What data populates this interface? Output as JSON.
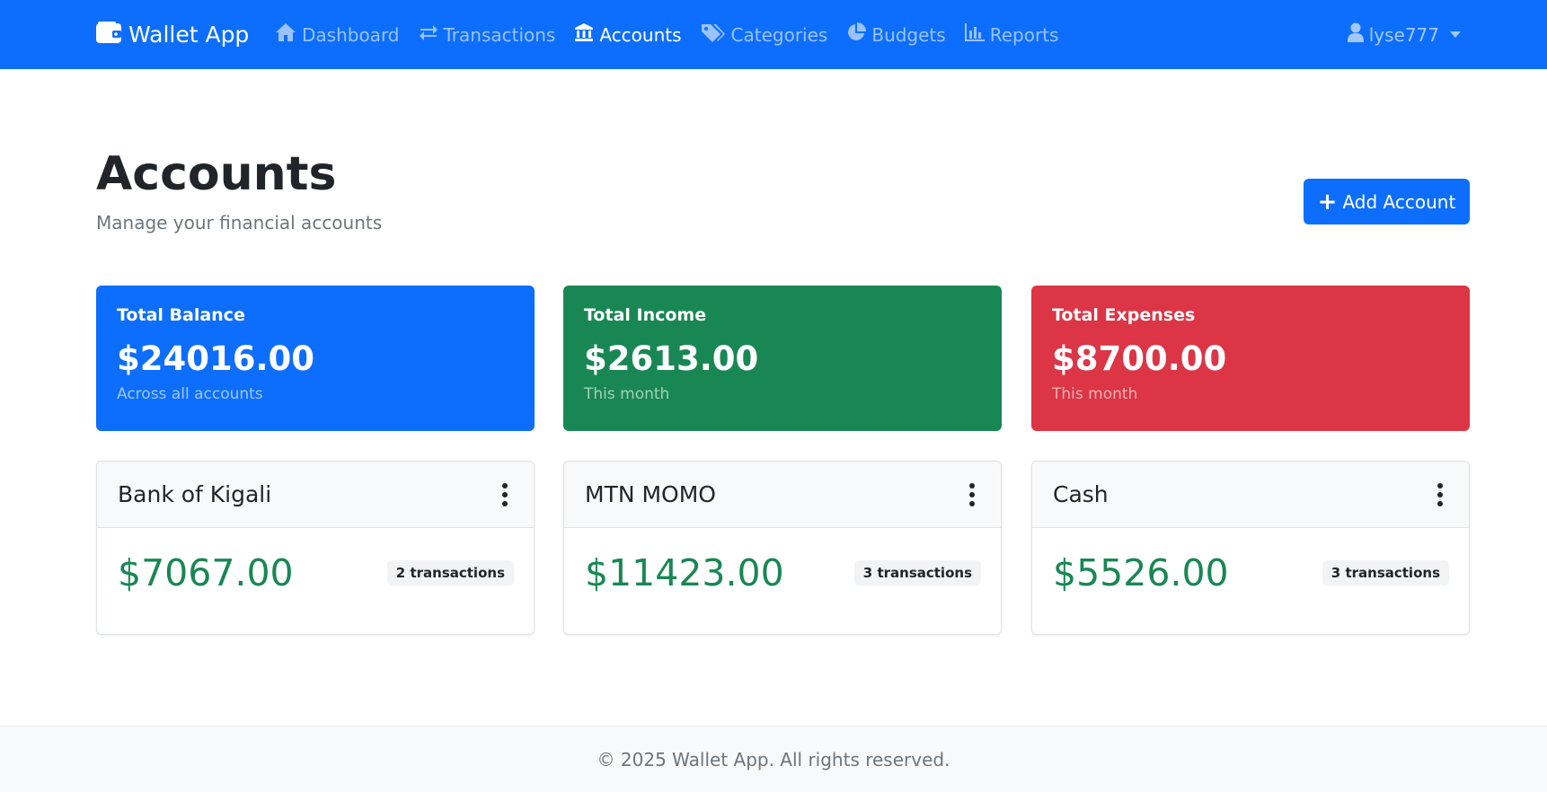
{
  "app": {
    "brand": "Wallet App",
    "brand_icon": "wallet-icon"
  },
  "nav": {
    "items": [
      {
        "label": "Dashboard",
        "icon": "home-icon"
      },
      {
        "label": "Transactions",
        "icon": "exchange-icon"
      },
      {
        "label": "Accounts",
        "icon": "bank-icon",
        "active": true
      },
      {
        "label": "Categories",
        "icon": "tags-icon"
      },
      {
        "label": "Budgets",
        "icon": "pie-chart-icon"
      },
      {
        "label": "Reports",
        "icon": "bar-chart-icon"
      }
    ],
    "user": {
      "name": "lyse777",
      "icon": "user-icon"
    }
  },
  "header": {
    "title": "Accounts",
    "subtitle": "Manage your financial accounts",
    "add_button": "Add Account"
  },
  "summary": [
    {
      "label": "Total Balance",
      "value": "$24016.00",
      "note": "Across all accounts",
      "color": "#0d6efd"
    },
    {
      "label": "Total Income",
      "value": "$2613.00",
      "note": "This month",
      "color": "#198754"
    },
    {
      "label": "Total Expenses",
      "value": "$8700.00",
      "note": "This month",
      "color": "#dc3545"
    }
  ],
  "accounts": [
    {
      "name": "Bank of Kigali",
      "balance": "$7067.00",
      "transactions": "2 transactions"
    },
    {
      "name": "MTN MOMO",
      "balance": "$11423.00",
      "transactions": "3 transactions"
    },
    {
      "name": "Cash",
      "balance": "$5526.00",
      "transactions": "3 transactions"
    }
  ],
  "footer": {
    "text": "© 2025 Wallet App. All rights reserved."
  },
  "colors": {
    "primary": "#0d6efd",
    "success": "#198754",
    "danger": "#dc3545"
  }
}
